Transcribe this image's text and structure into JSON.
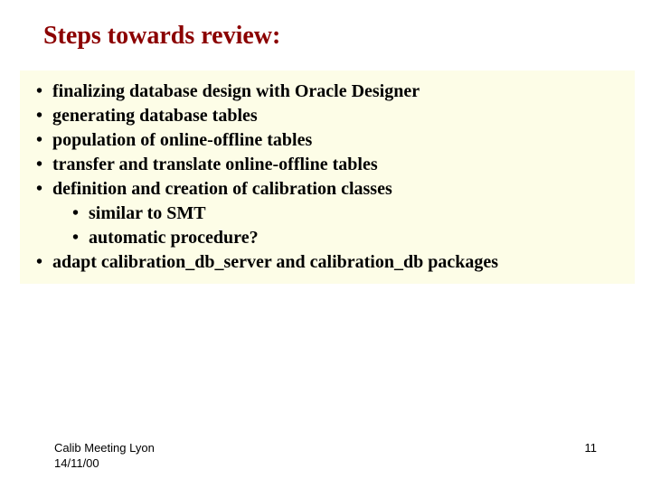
{
  "title": "Steps towards review:",
  "items": [
    "finalizing database design with Oracle Designer",
    "generating database tables",
    "population of online-offline tables",
    "transfer and translate online-offline tables",
    "definition and creation of calibration classes"
  ],
  "subitems": [
    "similar to SMT",
    "automatic procedure?"
  ],
  "last_item": "adapt calibration_db_server and calibration_db packages",
  "footer": {
    "venue": "Calib Meeting Lyon",
    "date": "14/11/00",
    "page": "11"
  }
}
